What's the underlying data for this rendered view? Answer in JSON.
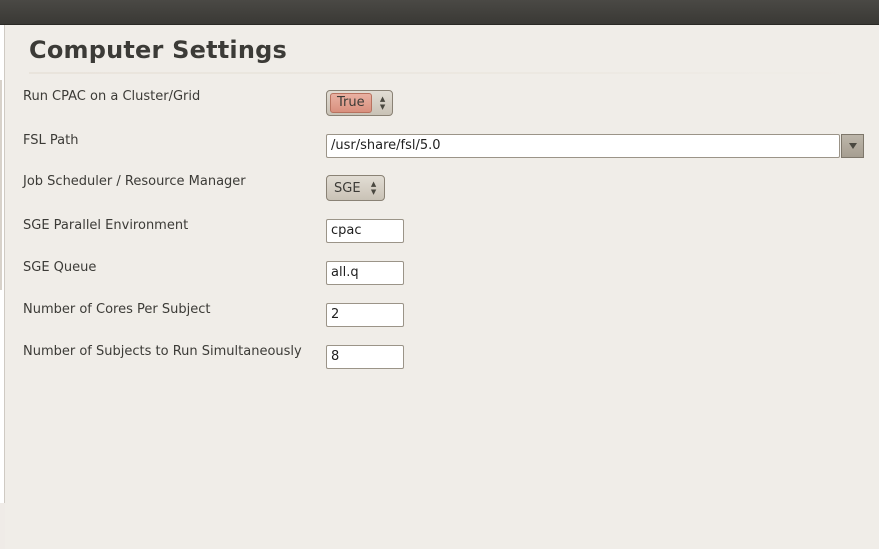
{
  "page": {
    "title": "Computer Settings"
  },
  "rows": [
    {
      "label": "Run CPAC on a Cluster/Grid",
      "value": "True",
      "control": "combo"
    },
    {
      "label": "FSL Path",
      "value": "/usr/share/fsl/5.0",
      "control": "path-combo"
    },
    {
      "label": "Job Scheduler / Resource Manager",
      "value": "SGE",
      "control": "combo"
    },
    {
      "label": "SGE Parallel Environment",
      "value": "cpac",
      "control": "text"
    },
    {
      "label": "SGE Queue",
      "value": "all.q",
      "control": "text"
    },
    {
      "label": "Number of Cores Per Subject",
      "value": "2",
      "control": "text"
    },
    {
      "label": "Number of Subjects to Run Simultaneously",
      "value": "8",
      "control": "text"
    }
  ],
  "icons": {
    "spin_arrows": "up-down-arrows-icon",
    "dropdown": "triangle-down-icon"
  },
  "colors": {
    "accent_true": "#d9907e",
    "background": "#f0ede8",
    "topbar": "#3c3b37"
  }
}
